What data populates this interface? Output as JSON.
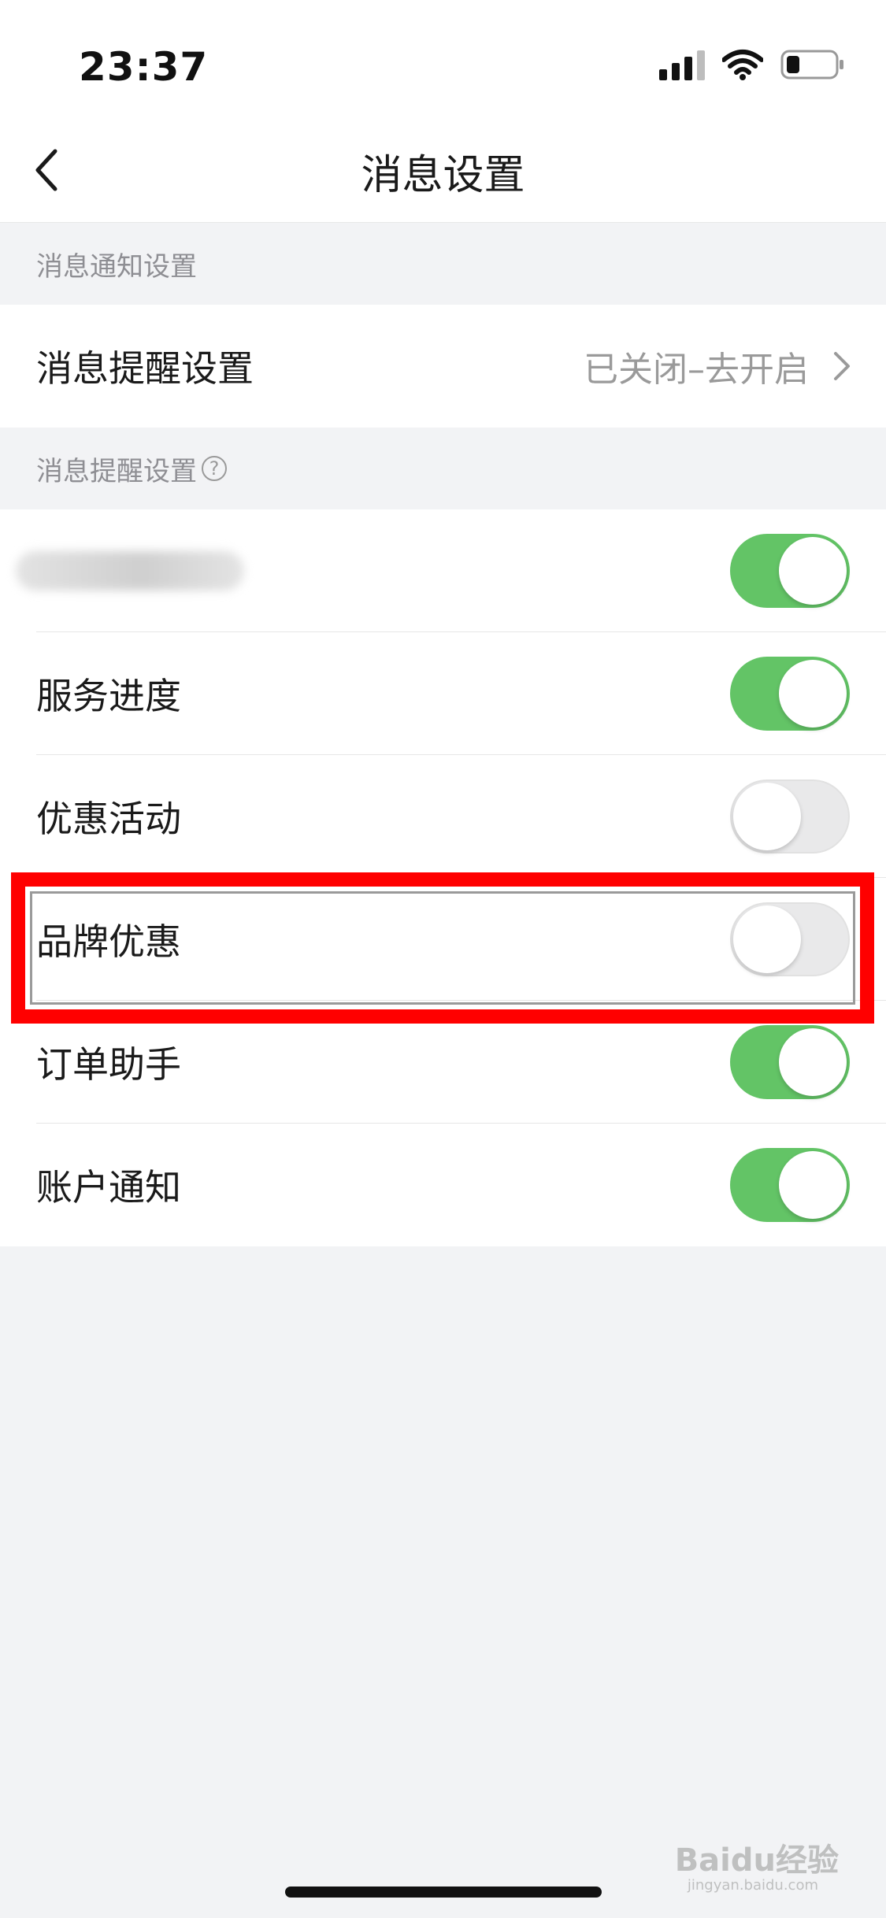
{
  "status_bar": {
    "time": "23:37",
    "icons": [
      "cellular-signal-icon",
      "wifi-icon",
      "battery-icon"
    ]
  },
  "nav": {
    "back_icon": "chevron-left-icon",
    "title": "消息设置"
  },
  "section_notification": {
    "header": "消息通知设置",
    "row": {
      "label": "消息提醒设置",
      "value": "已关闭–去开启",
      "icon": "chevron-right-icon"
    }
  },
  "section_reminder": {
    "header": "消息提醒设置",
    "help_icon": "question-circle-icon",
    "items": [
      {
        "label": "",
        "enabled": true,
        "blurred": true
      },
      {
        "label": "服务进度",
        "enabled": true
      },
      {
        "label": "优惠活动",
        "enabled": false
      },
      {
        "label": "品牌优惠",
        "enabled": false,
        "highlighted": true
      },
      {
        "label": "订单助手",
        "enabled": true
      },
      {
        "label": "账户通知",
        "enabled": true
      }
    ]
  },
  "watermark": {
    "text": "Baidu经验",
    "sub": "jingyan.baidu.com"
  },
  "colors": {
    "toggle_on": "#63c466",
    "toggle_off": "#e9e9ea",
    "highlight": "#ff0000",
    "background": "#f2f3f5"
  }
}
